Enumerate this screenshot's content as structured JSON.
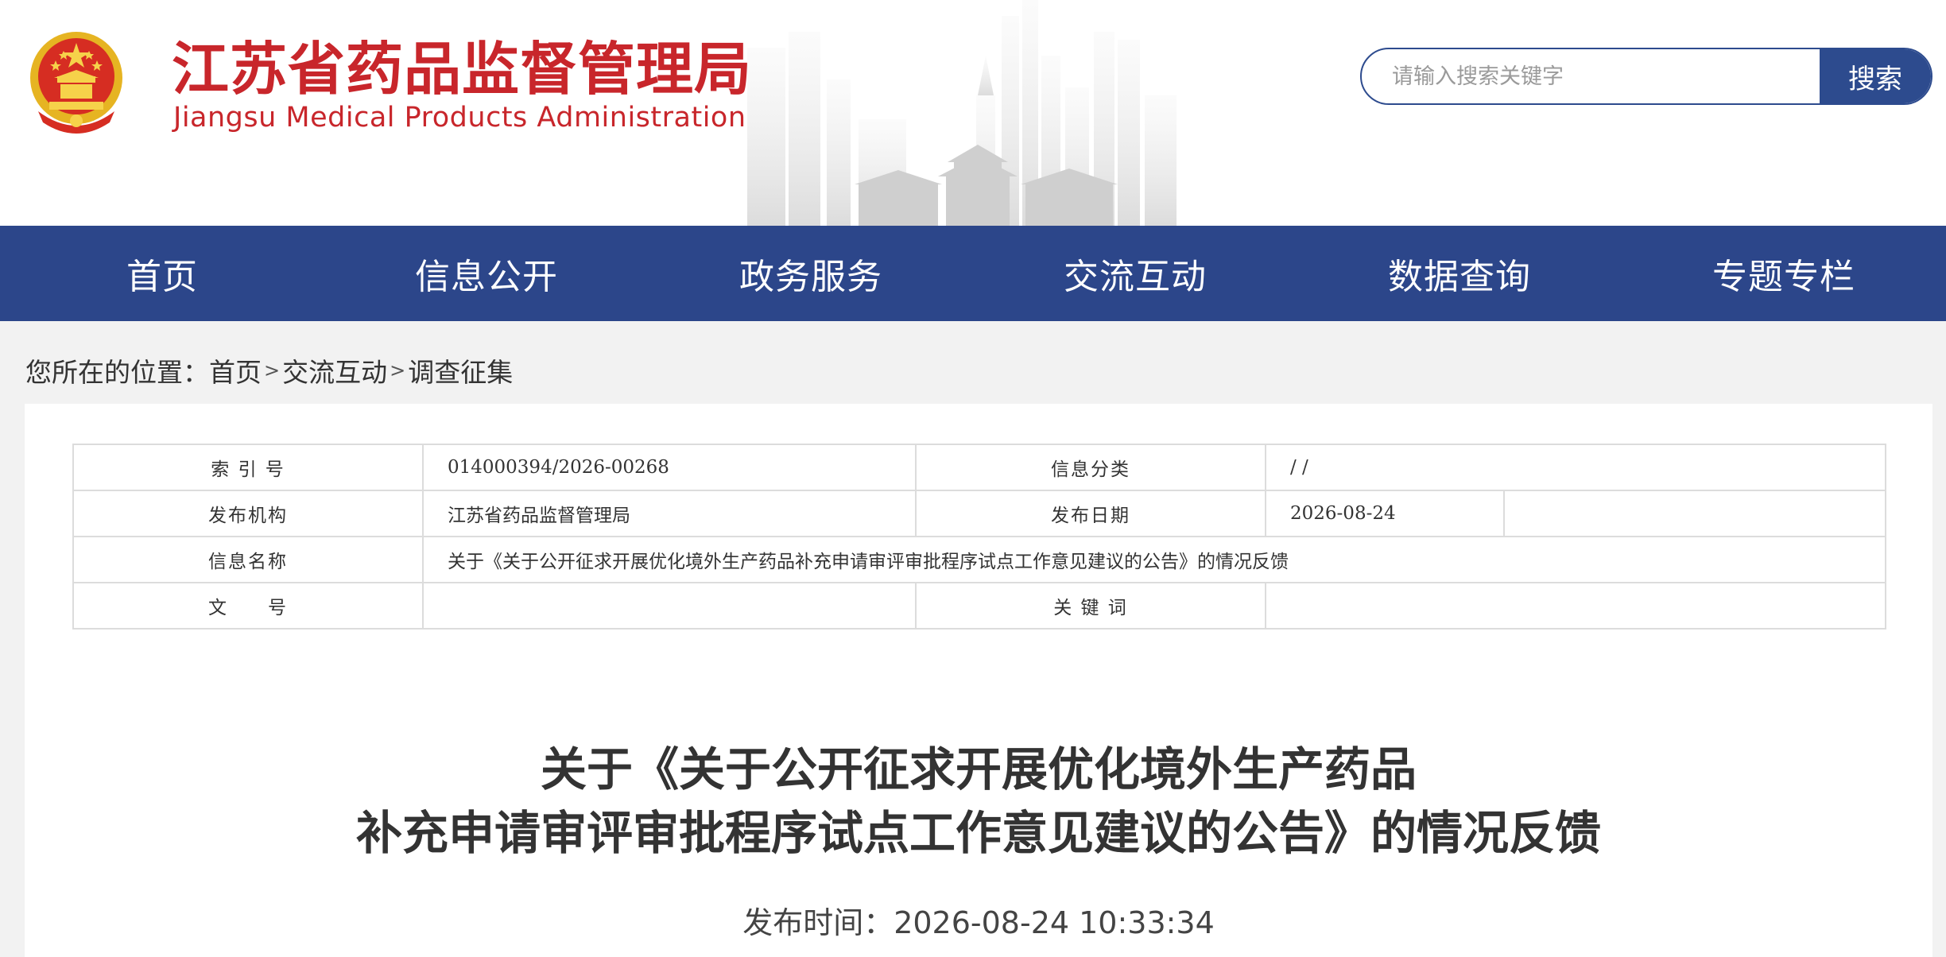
{
  "header": {
    "title_cn": "江苏省药品监督管理局",
    "title_en": "Jiangsu Medical Products Administration",
    "emblem_icon": "national-emblem-icon"
  },
  "search": {
    "placeholder": "请输入搜索关键字",
    "value": "",
    "button_label": "搜索"
  },
  "nav": {
    "items": [
      {
        "label": "首页"
      },
      {
        "label": "信息公开"
      },
      {
        "label": "政务服务"
      },
      {
        "label": "交流互动"
      },
      {
        "label": "数据查询"
      },
      {
        "label": "专题专栏"
      }
    ]
  },
  "breadcrumb": {
    "prefix": "您所在的位置：",
    "items": [
      "首页",
      "交流互动",
      "调查征集"
    ],
    "separator": ">"
  },
  "meta": {
    "index_label": "索 引 号",
    "index_value": "014000394/2026-00268",
    "category_label": "信息分类",
    "category_value": "/ /",
    "publisher_label": "发布机构",
    "publisher_value": "江苏省药品监督管理局",
    "date_label": "发布日期",
    "date_value": "2026-08-24",
    "name_label": "信息名称",
    "name_value": "关于《关于公开征求开展优化境外生产药品补充申请审评审批程序试点工作意见建议的公告》的情况反馈",
    "docno_label": "文　　号",
    "docno_value": "",
    "keywords_label": "关 键 词",
    "keywords_value": ""
  },
  "article": {
    "title_line1": "关于《关于公开征求开展优化境外生产药品",
    "title_line2": "补充申请审评审批程序试点工作意见建议的公告》的情况反馈",
    "pub_time_label": "发布时间：",
    "pub_time_value": "2026-08-24 10:33:34"
  },
  "colors": {
    "brand_red": "#c8262b",
    "nav_blue": "#2c468a",
    "search_blue": "#2d4b8e"
  }
}
